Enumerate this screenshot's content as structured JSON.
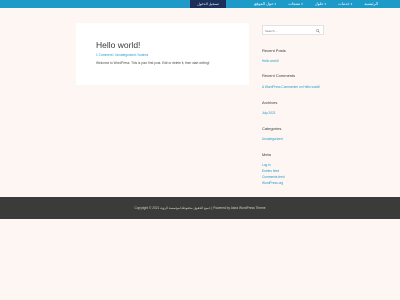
{
  "nav": {
    "login_label": "تسجيل الدخول",
    "items": [
      {
        "label": "الرئيسية",
        "has_dropdown": false
      },
      {
        "label": "خدمات",
        "has_dropdown": true
      },
      {
        "label": "حلول",
        "has_dropdown": true
      },
      {
        "label": "منتجات",
        "has_dropdown": true
      },
      {
        "label": "حول الموقع",
        "has_dropdown": true
      }
    ],
    "caret_glyph": "▾"
  },
  "post": {
    "title": "Hello world!",
    "meta": "1 Comment / Uncategorized / bushra",
    "excerpt": "Welcome to WordPress. This is your first post. Edit or delete it, then start writing!"
  },
  "sidebar": {
    "search_placeholder": "Search ...",
    "search_icon": "magnifier-icon",
    "recent_posts": {
      "heading": "Recent Posts",
      "items": [
        "Hello world!"
      ]
    },
    "recent_comments": {
      "heading": "Recent Comments",
      "items": [
        "A WordPress Commenter on Hello world!"
      ]
    },
    "archives": {
      "heading": "Archives",
      "items": [
        "July 2021"
      ]
    },
    "categories": {
      "heading": "Categories",
      "items": [
        "Uncategorized"
      ]
    },
    "meta": {
      "heading": "Meta",
      "items": [
        "Log in",
        "Entries feed",
        "Comments feed",
        "WordPress.org"
      ]
    }
  },
  "footer": {
    "text": "Copyright © 2021 جميع الحقوق محفوظة لمؤسسة الرؤية | Powered by Astra WordPress Theme"
  },
  "colors": {
    "nav_bg": "#1d9ac8",
    "login_bg": "#1a2f5a",
    "page_bg": "#fdf6f2",
    "link": "#1d9ac8",
    "footer_bg": "#3b3b3b"
  }
}
